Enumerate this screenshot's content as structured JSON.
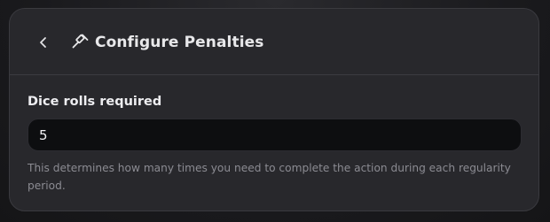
{
  "modal": {
    "title": "Configure Penalties",
    "title_icon": "gavel-icon",
    "back_icon": "chevron-left-icon"
  },
  "field": {
    "label": "Dice rolls required",
    "value": "5",
    "help": "This determines how many times you need to complete the action during each regularity period."
  },
  "colors": {
    "modal_bg": "#28282c",
    "input_bg": "#0d0e10",
    "text": "#e8e8ea",
    "muted": "#8b8b92"
  }
}
